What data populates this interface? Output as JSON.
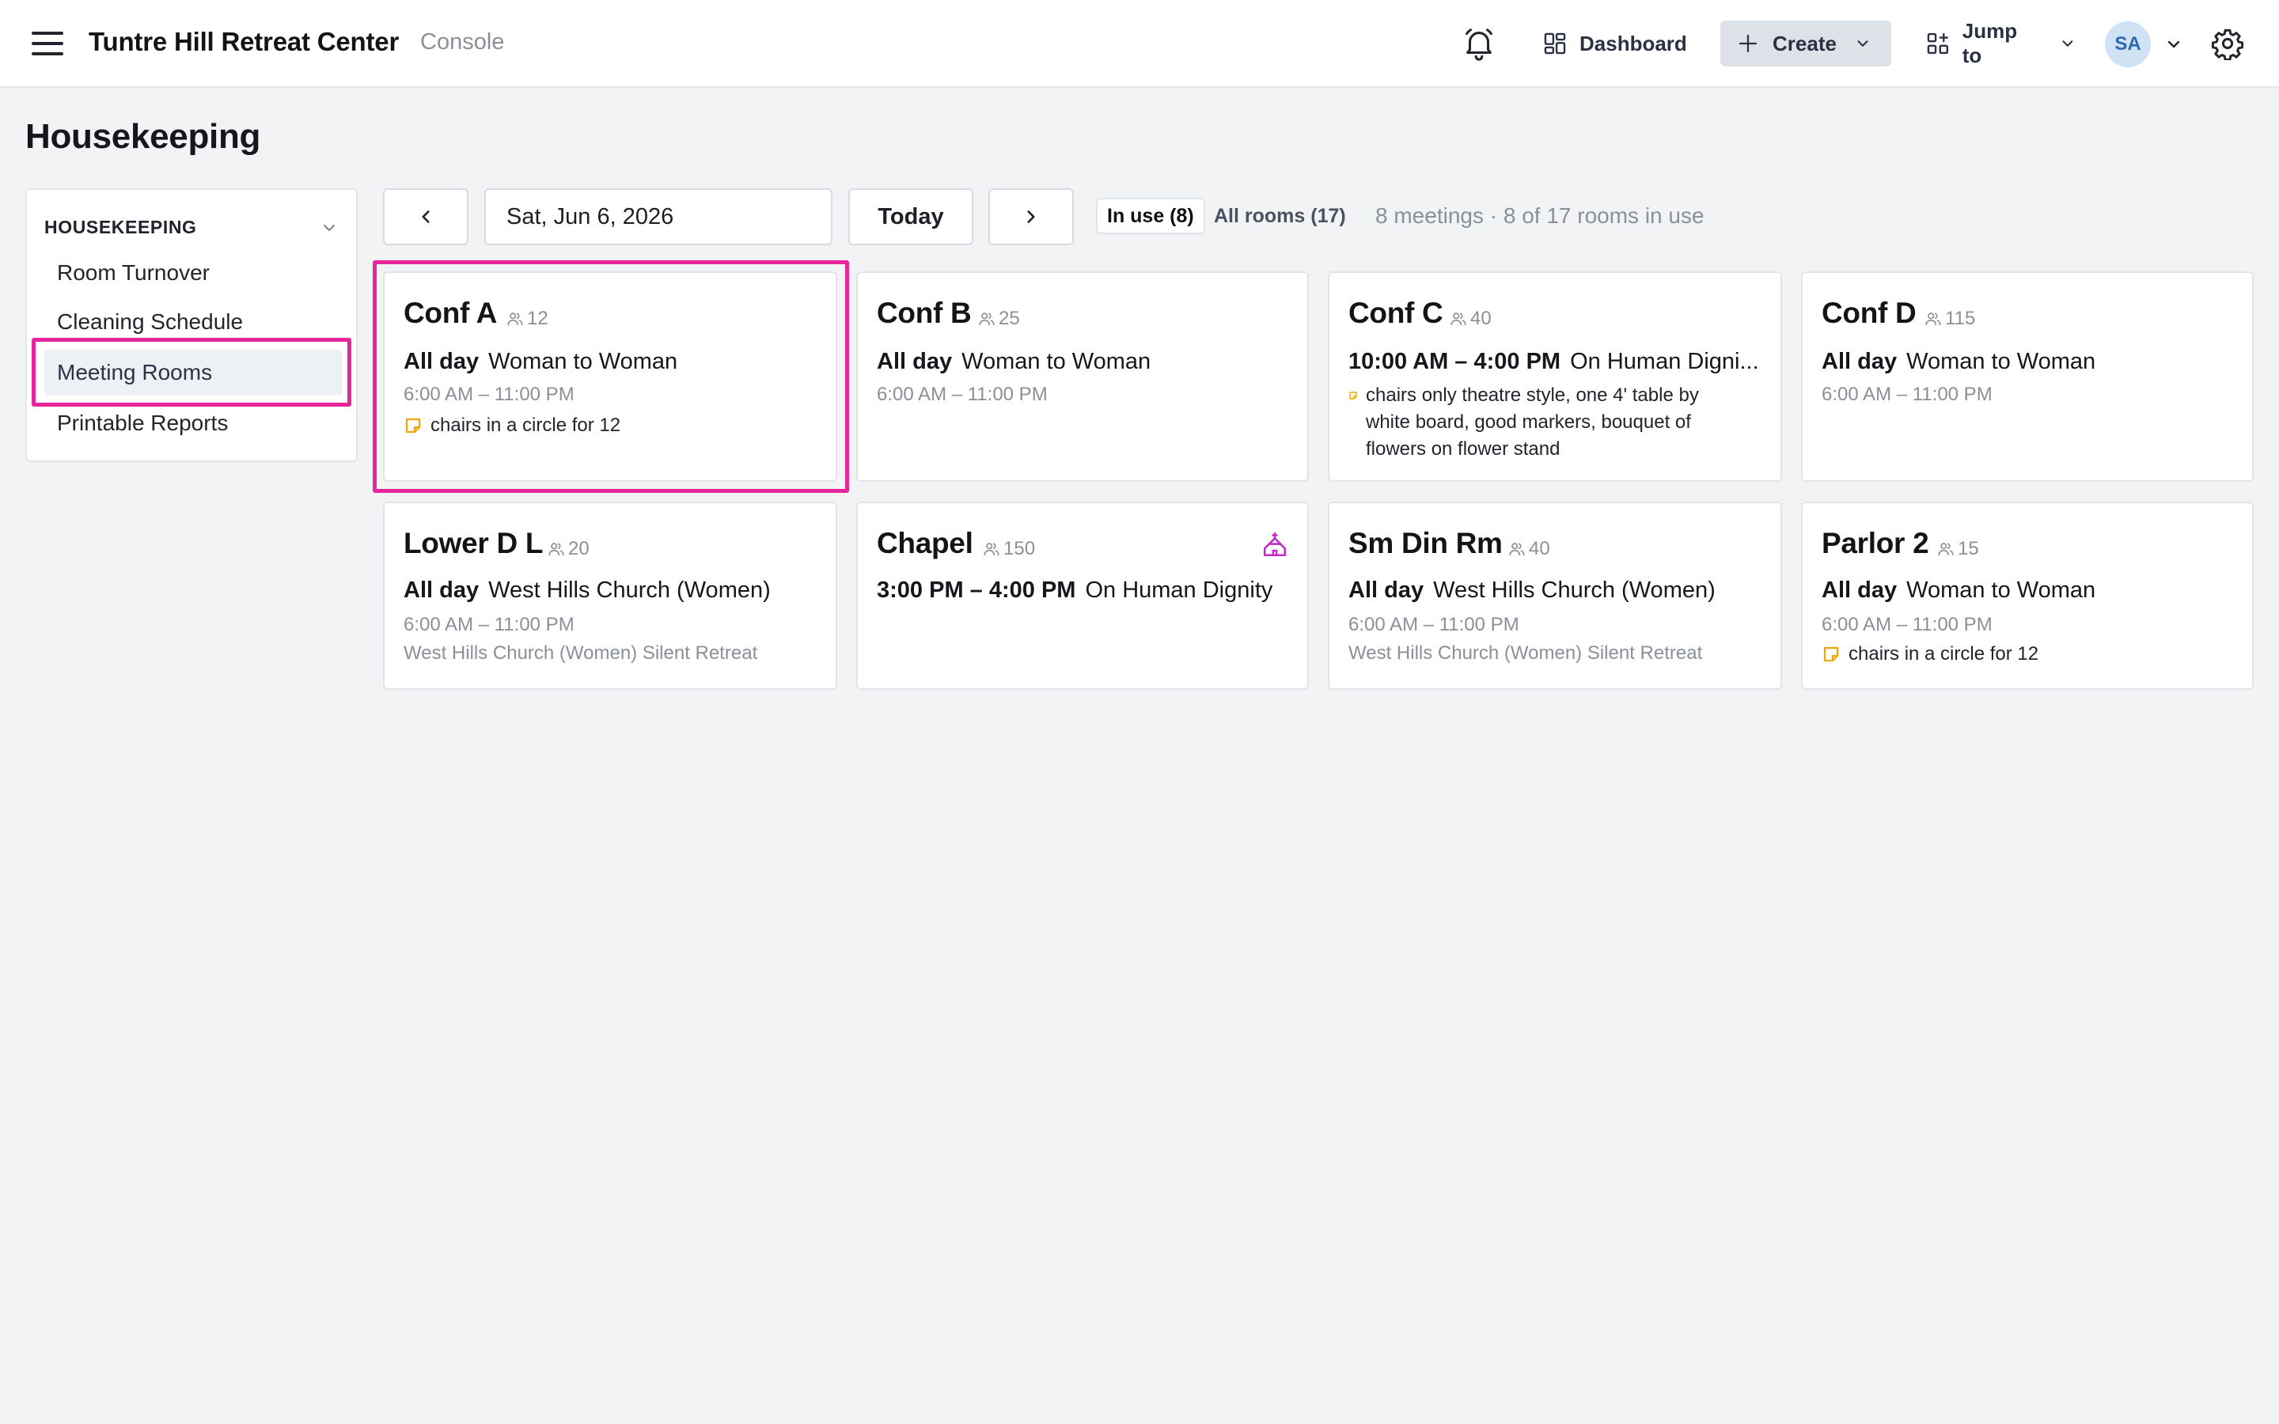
{
  "header": {
    "app_title": "Tuntre Hill Retreat Center",
    "app_sub": "Console",
    "dashboard_label": "Dashboard",
    "create_label": "Create",
    "jump_label": "Jump to",
    "avatar_initials": "SA"
  },
  "page": {
    "title": "Housekeeping"
  },
  "sidebar": {
    "heading": "HOUSEKEEPING",
    "items": [
      {
        "label": "Room Turnover"
      },
      {
        "label": "Cleaning Schedule"
      },
      {
        "label": "Meeting Rooms",
        "active": true
      },
      {
        "label": "Printable Reports"
      }
    ]
  },
  "toolbar": {
    "date": "Sat, Jun 6, 2026",
    "today_label": "Today",
    "in_use_label": "In use (8)",
    "all_rooms_label": "All rooms (17)",
    "summary": "8 meetings · 8 of 17 rooms in use"
  },
  "rooms": [
    {
      "name": "Conf A",
      "capacity": "12",
      "when": "All day",
      "event": "Woman to Woman",
      "time": "6:00 AM – 11:00 PM",
      "note": "chairs in a circle for 12"
    },
    {
      "name": "Conf B",
      "capacity": "25",
      "when": "All day",
      "event": "Woman to Woman",
      "time": "6:00 AM – 11:00 PM"
    },
    {
      "name": "Conf C",
      "capacity": "40",
      "when": "10:00 AM – 4:00 PM",
      "event": "On Human Digni...",
      "note_lines": [
        "chairs only theatre style, one 4' table by",
        "white board, good markers, bouquet of",
        "flowers on flower stand"
      ]
    },
    {
      "name": "Conf D",
      "capacity": "115",
      "when": "All day",
      "event": "Woman to Woman",
      "time": "6:00 AM – 11:00 PM"
    },
    {
      "name": "Lower D L",
      "capacity": "20",
      "when": "All day",
      "event": "West Hills Church (Women)",
      "time": "6:00 AM – 11:00 PM",
      "sub": "West Hills Church (Women) Silent Retreat"
    },
    {
      "name": "Chapel",
      "capacity": "150",
      "when": "3:00 PM – 4:00 PM",
      "event": "On Human Dignity"
    },
    {
      "name": "Sm Din Rm",
      "capacity": "40",
      "when": "All day",
      "event": "West Hills Church (Women)",
      "time": "6:00 AM – 11:00 PM",
      "sub": "West Hills Church (Women) Silent Retreat"
    },
    {
      "name": "Parlor 2",
      "capacity": "15",
      "when": "All day",
      "event": "Woman to Woman",
      "time": "6:00 AM – 11:00 PM",
      "note": "chairs in a circle for 12"
    }
  ],
  "colors": {
    "accent_highlight": "#e6269a",
    "note_icon": "#f0a500",
    "chapel_icon": "#c02cc7",
    "avatar_bg": "#cfe3f5"
  },
  "icons": {
    "menu": "hamburger-icon",
    "bell": "bell-icon",
    "dashboard": "grid-icon",
    "create": "plus-icon",
    "jump": "apps-icon",
    "settings": "gear-icon",
    "capacity": "people-icon",
    "note": "sticky-note-icon",
    "chapel": "church-icon"
  }
}
